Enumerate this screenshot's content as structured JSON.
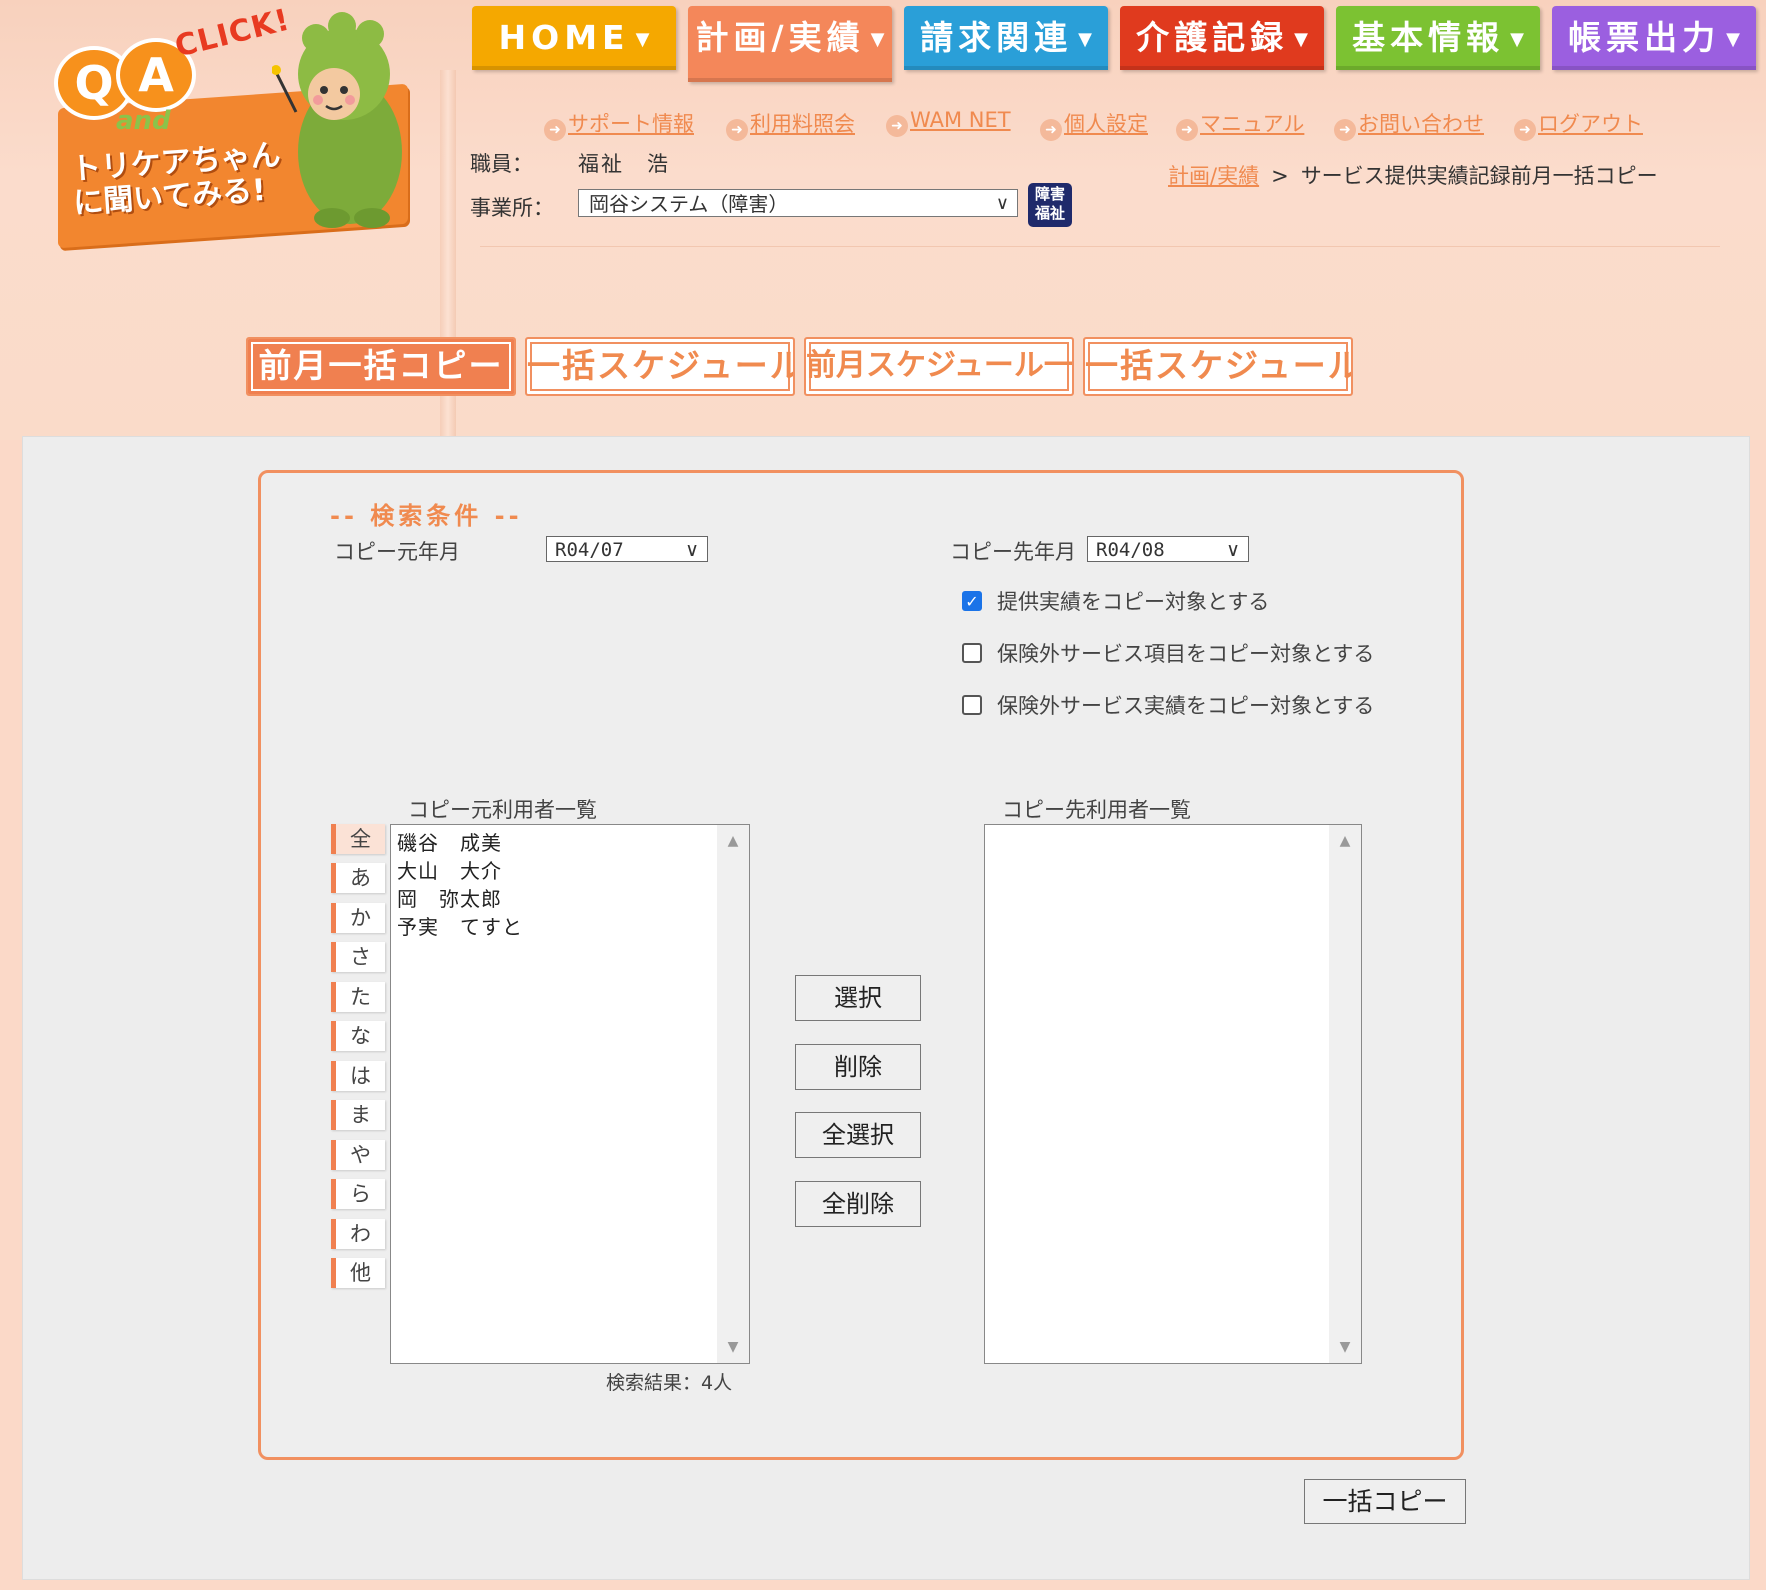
{
  "logo": {
    "q": "Q",
    "a": "A",
    "click": "CLICK!",
    "and": "and",
    "line1": "トリケアちゃん",
    "line2": "に聞いてみる!"
  },
  "topnav": [
    {
      "label": "HOME",
      "color": "#f5a800"
    },
    {
      "label": "計画/実績",
      "color": "#f4875a"
    },
    {
      "label": "請求関連",
      "color": "#2a9fd8"
    },
    {
      "label": "介護記録",
      "color": "#e03a1e"
    },
    {
      "label": "基本情報",
      "color": "#7cc232"
    },
    {
      "label": "帳票出力",
      "color": "#9b5fe0"
    }
  ],
  "links": [
    "サポート情報",
    "利用料照会",
    "WAM NET",
    "個人設定",
    "マニュアル",
    "お問い合わせ",
    "ログアウト"
  ],
  "staff": {
    "label": "職員：",
    "name": "福祉　浩"
  },
  "office": {
    "label": "事業所：",
    "value": "岡谷システム（障害）",
    "badge_line1": "障害",
    "badge_line2": "福祉"
  },
  "breadcrumb": {
    "parent": "計画/実績",
    "separator": ">",
    "current": "サービス提供実績記録前月一括コピー"
  },
  "subtabs": [
    "前月一括コピー",
    "一括スケジュール取込",
    "前月スケジュール一括コピー",
    "一括スケジュール展開"
  ],
  "search": {
    "legend": "-- 検索条件 --",
    "source_month_label": "コピー元年月",
    "source_month": "R04/07",
    "dest_month_label": "コピー先年月",
    "dest_month": "R04/08",
    "checkboxes": [
      {
        "label": "提供実績をコピー対象とする",
        "checked": true
      },
      {
        "label": "保険外サービス項目をコピー対象とする",
        "checked": false
      },
      {
        "label": "保険外サービス実績をコピー対象とする",
        "checked": false
      }
    ]
  },
  "source_list": {
    "title": "コピー元利用者一覧",
    "items": [
      "磯谷　成美",
      "大山　大介",
      "岡　弥太郎",
      "予実　てすと"
    ],
    "result": "検索結果：4人"
  },
  "dest_list": {
    "title": "コピー先利用者一覧",
    "items": []
  },
  "kana_filter": [
    "全",
    "あ",
    "か",
    "さ",
    "た",
    "な",
    "は",
    "ま",
    "や",
    "ら",
    "わ",
    "他"
  ],
  "actions": {
    "select": "選択",
    "delete": "削除",
    "select_all": "全選択",
    "delete_all": "全削除"
  },
  "submit": "一括コピー"
}
